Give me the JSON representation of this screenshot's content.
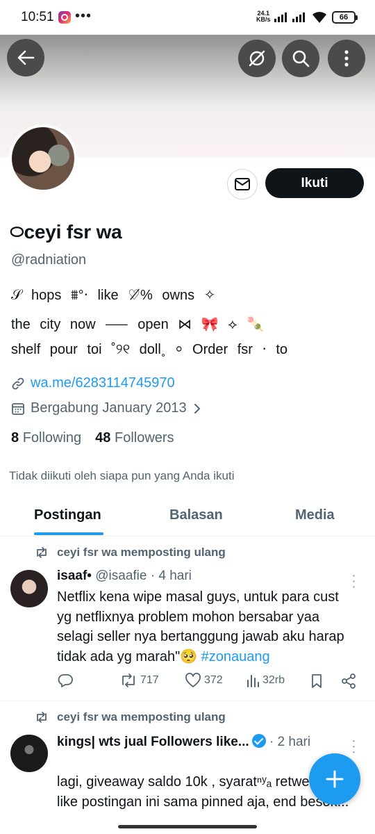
{
  "status_bar": {
    "time": "10:51",
    "dots": "•••",
    "speed_value": "24.1",
    "speed_unit": "KB/s",
    "battery": "66"
  },
  "profile": {
    "display_name": "࿀ceyi fsr wa",
    "handle": "@radniation",
    "bio_lines": [
      "𝒮 hops  ⩩°‧  like  ♡̸%  owns  ✧",
      "the  city  now  ⸺  open  ⋈  🎀          ⟡  🍡",
      "   shelf  pour  toi  ˚୨୧  doll˳            ⸰  Order fsr ‧  to"
    ],
    "link": "wa.me/6283114745970",
    "joined": "Bergabung January 2013",
    "following_count": "8",
    "following_label": "Following",
    "followers_count": "48",
    "followers_label": "Followers",
    "not_followed_text": "Tidak diikuti oleh siapa pun yang Anda ikuti",
    "follow_button": "Ikuti"
  },
  "tabs": [
    {
      "label": "Postingan",
      "active": true
    },
    {
      "label": "Balasan",
      "active": false
    },
    {
      "label": "Media",
      "active": false
    }
  ],
  "posts": [
    {
      "repost_label": "ceyi fsr wa memposting ulang",
      "name": "isaaf•",
      "meta": "@isaafie · 4 hari",
      "text": "Netflix kena wipe masal guys, untuk para cust yg netflixnya problem mohon bersabar yaa selagi seller nya bertanggung jawab aku harap tidak ada yg marah\"🥺 ",
      "hashtag": "#zonauang",
      "reposts": "717",
      "likes": "372",
      "views": "32rb"
    },
    {
      "repost_label": "ceyi fsr wa memposting ulang",
      "name": "kings| wts jual Followers like...",
      "meta": "· 2 hari",
      "text": "lagi,  giveaway  saldo  10k  ,  syaratⁿʸₐ retweet  dan  like  postingan  ini  sama pinned  aja,  end  besok..."
    }
  ],
  "colors": {
    "accent": "#1d9bf0",
    "text": "#0f1419",
    "muted": "#536471"
  }
}
